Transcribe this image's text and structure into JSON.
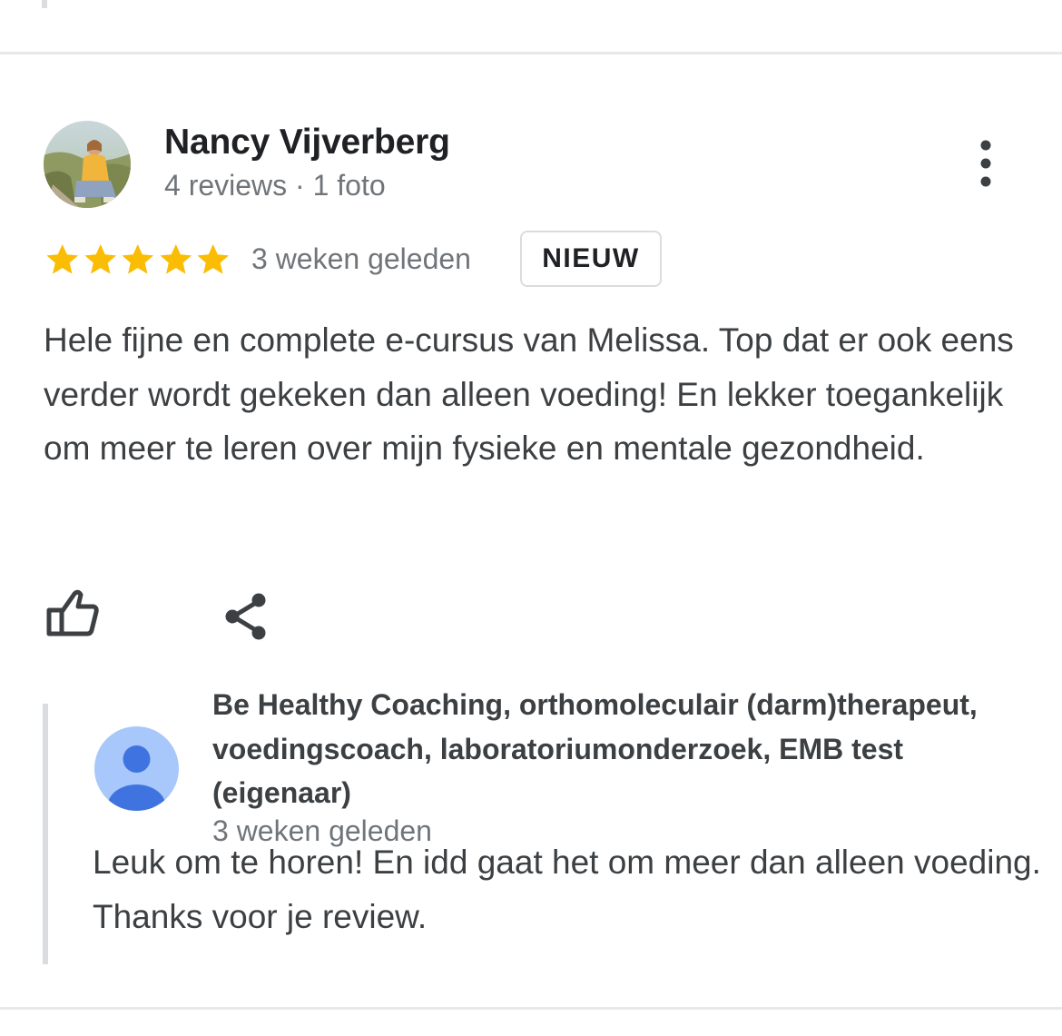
{
  "review": {
    "reviewer_name": "Nancy Vijverberg",
    "reviewer_meta": "4 reviews · 1 foto",
    "rating": 5,
    "rating_max": 5,
    "date": "3 weken geleden",
    "badge": "NIEUW",
    "text": "Hele fijne en complete e-cursus van Melissa. Top dat er ook eens verder wordt gekeken dan alleen voeding! En lekker toegankelijk om meer te leren over mijn fysieke en mentale gezondheid."
  },
  "owner_reply": {
    "name": "Be Healthy Coaching, orthomoleculair (darm)therapeut, voedingscoach, laboratoriumonderzoek, EMB test (eigenaar)",
    "date": "3 weken geleden",
    "text": "Leuk om te horen! En idd gaat het om meer dan alleen voeding. Thanks voor je review."
  },
  "icons": {
    "more": "more-vert-icon",
    "like": "thumb-up-icon",
    "share": "share-icon",
    "star": "star-icon",
    "owner_avatar": "person-icon"
  },
  "colors": {
    "star": "#fbbc04",
    "owner_avatar_bg": "#a8c7fa",
    "owner_avatar_fg": "#3f74e0"
  }
}
